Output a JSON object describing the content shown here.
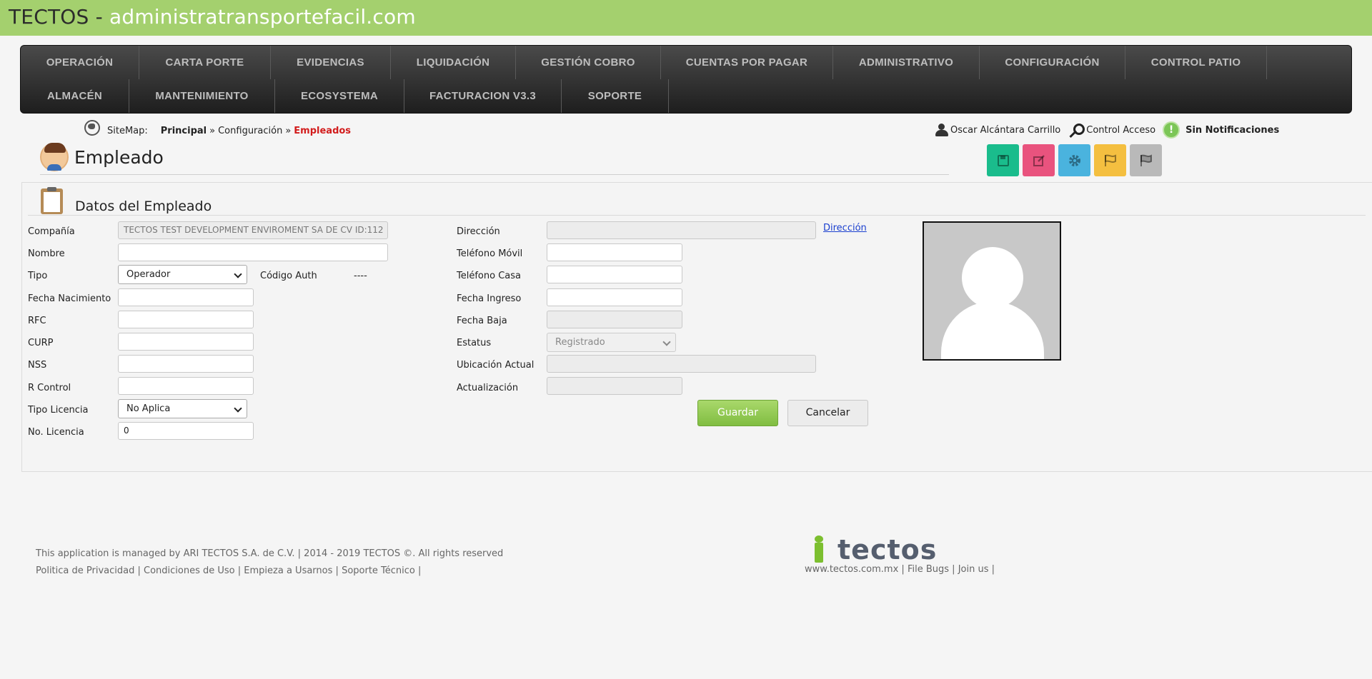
{
  "window": {
    "brand": "TECTOS",
    "separator": " - ",
    "domain": "administratransportefacil.com"
  },
  "nav": {
    "row1": [
      "OPERACIÓN",
      "CARTA PORTE",
      "EVIDENCIAS",
      "LIQUIDACIÓN",
      "GESTIÓN COBRO",
      "CUENTAS POR PAGAR",
      "ADMINISTRATIVO",
      "CONFIGURACIÓN",
      "CONTROL PATIO"
    ],
    "row2": [
      "ALMACÉN",
      "MANTENIMIENTO",
      "ECOSYSTEMA",
      "FACTURACION V3.3",
      "SOPORTE"
    ]
  },
  "sitemap": {
    "label": "SiteMap:",
    "principal": "Principal",
    "sep": "»",
    "configuracion": "Configuración",
    "current": "Empleados"
  },
  "page": {
    "title": "Empleado"
  },
  "user": {
    "name": "Oscar Alcántara Carrillo",
    "access": "Control Acceso",
    "notif_mark": "!",
    "notifications": "Sin Notificaciones"
  },
  "actions": [
    {
      "name": "save",
      "icon": "floppy-icon",
      "color": "#1abc8c"
    },
    {
      "name": "edit",
      "icon": "edit-icon",
      "color": "#e9537e"
    },
    {
      "name": "settings",
      "icon": "gear-icon",
      "color": "#4ab3de"
    },
    {
      "name": "flag",
      "icon": "flag-icon",
      "color": "#f4bf40"
    },
    {
      "name": "finish",
      "icon": "checkered-flag-icon",
      "color": "#b9b9b9"
    }
  ],
  "panel": {
    "title": "Datos del Empleado"
  },
  "form": {
    "compania": {
      "label": "Compañía",
      "value": "TECTOS TEST DEVELOPMENT ENVIROMENT SA DE CV   ID:112"
    },
    "nombre": {
      "label": "Nombre",
      "value": ""
    },
    "tipo": {
      "label": "Tipo",
      "value": "Operador"
    },
    "codigo_auth": {
      "label": "Código Auth",
      "value": "----"
    },
    "fecha_nacimiento": {
      "label": "Fecha Nacimiento",
      "value": ""
    },
    "rfc": {
      "label": "RFC",
      "value": ""
    },
    "curp": {
      "label": "CURP",
      "value": ""
    },
    "nss": {
      "label": "NSS",
      "value": ""
    },
    "r_control": {
      "label": "R Control",
      "value": ""
    },
    "tipo_licencia": {
      "label": "Tipo Licencia",
      "value": "No Aplica"
    },
    "no_licencia": {
      "label": "No. Licencia",
      "value": "0"
    },
    "direccion": {
      "label": "Dirección",
      "value": "",
      "link": "Dirección"
    },
    "telefono_movil": {
      "label": "Teléfono Móvil",
      "value": ""
    },
    "telefono_casa": {
      "label": "Teléfono Casa",
      "value": ""
    },
    "fecha_ingreso": {
      "label": "Fecha Ingreso",
      "value": ""
    },
    "fecha_baja": {
      "label": "Fecha Baja",
      "value": ""
    },
    "estatus": {
      "label": "Estatus",
      "value": "Registrado"
    },
    "ubicacion_actual": {
      "label": "Ubicación Actual",
      "value": ""
    },
    "actualizacion": {
      "label": "Actualización",
      "value": ""
    }
  },
  "buttons": {
    "save": "Guardar",
    "cancel": "Cancelar"
  },
  "footer": {
    "managed": "This application is managed by ARI TECTOS S.A. de C.V. | 2014 - 2019 TECTOS ©. All rights reserved",
    "links_left": [
      "Politica de Privacidad",
      "Condiciones de Uso",
      "Empieza a Usarnos",
      "Soporte Técnico"
    ],
    "logo_text": "tectos",
    "links_right": [
      "www.tectos.com.mx",
      "File Bugs",
      "Join us"
    ]
  }
}
